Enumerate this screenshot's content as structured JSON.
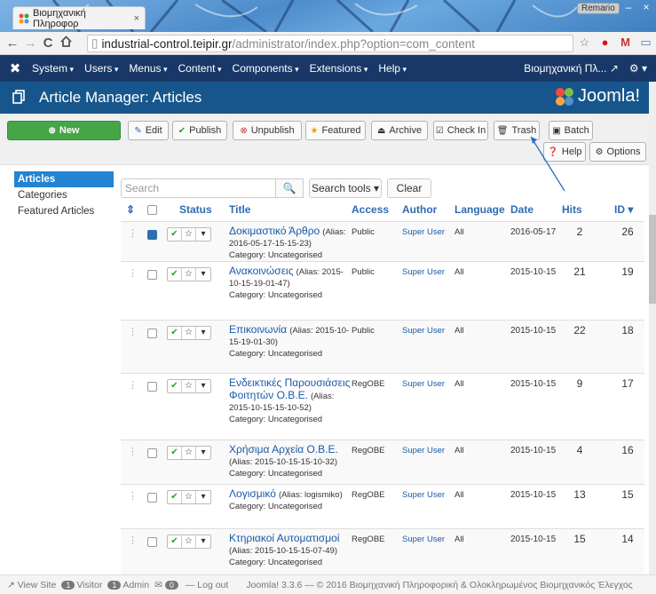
{
  "browser": {
    "tab_title": "Βιομηχανική Πληροφορ",
    "tab_close": "×",
    "user_badge": "Remario",
    "url_host": "industrial-control.teipir.gr",
    "url_path": "/administrator/index.php?option=com_content"
  },
  "topbar": {
    "menu": [
      "System",
      "Users",
      "Menus",
      "Content",
      "Components",
      "Extensions",
      "Help"
    ],
    "site_name": "Βιομηχανική Πλ..."
  },
  "header": {
    "title": "Article Manager: Articles",
    "logo_text": "Joomla!"
  },
  "toolbar": {
    "new": "New",
    "edit": "Edit",
    "publish": "Publish",
    "unpublish": "Unpublish",
    "featured": "Featured",
    "archive": "Archive",
    "checkin": "Check In",
    "trash": "Trash",
    "batch": "Batch",
    "help": "Help",
    "options": "Options"
  },
  "sidebar": {
    "items": [
      "Articles",
      "Categories",
      "Featured Articles"
    ]
  },
  "search": {
    "placeholder": "Search",
    "tools": "Search tools ▾",
    "clear": "Clear"
  },
  "table": {
    "headers": {
      "sort": "⇕",
      "status": "Status",
      "title": "Title",
      "access": "Access",
      "author": "Author",
      "language": "Language",
      "date": "Date",
      "hits": "Hits",
      "id": "ID ▾"
    },
    "rows": [
      {
        "title": "Δοκιμαστικό Άρθρο",
        "alias": "(Alias: 2016-05-17-15-15-23)",
        "category": "Category: Uncategorised",
        "access": "Public",
        "author": "Super User",
        "language": "All",
        "date": "2016-05-17",
        "hits": "2",
        "id": "26",
        "checked": true
      },
      {
        "title": "Ανακοινώσεις",
        "alias": "(Alias: 2015-10-15-19-01-47)",
        "category": "Category: Uncategorised",
        "access": "Public",
        "author": "Super User",
        "language": "All",
        "date": "2015-10-15",
        "hits": "21",
        "id": "19",
        "checked": false
      },
      {
        "title": "Επικοινωνία",
        "alias": "(Alias: 2015-10-15-19-01-30)",
        "category": "Category: Uncategorised",
        "access": "Public",
        "author": "Super User",
        "language": "All",
        "date": "2015-10-15",
        "hits": "22",
        "id": "18",
        "checked": false
      },
      {
        "title": "Ενδεικτικές Παρουσιάσεις Φοιτητών Ο.Β.Ε.",
        "alias": "(Alias: 2015-10-15-15-10-52)",
        "category": "Category: Uncategorised",
        "access": "RegOBE",
        "author": "Super User",
        "language": "All",
        "date": "2015-10-15",
        "hits": "9",
        "id": "17",
        "checked": false
      },
      {
        "title": "Χρήσιμα Αρχεία Ο.Β.Ε.",
        "alias": "(Alias: 2015-10-15-15-10-32)",
        "category": "Category: Uncategorised",
        "access": "RegOBE",
        "author": "Super User",
        "language": "All",
        "date": "2015-10-15",
        "hits": "4",
        "id": "16",
        "checked": false
      },
      {
        "title": "Λογισμικό",
        "alias": "(Alias: logismiko)",
        "category": "Category: Uncategorised",
        "access": "RegOBE",
        "author": "Super User",
        "language": "All",
        "date": "2015-10-15",
        "hits": "13",
        "id": "15",
        "checked": false
      },
      {
        "title": "Κτηριακοί Αυτοματισμοί",
        "alias": "(Alias: 2015-10-15-15-07-49)",
        "category": "Category: Uncategorised",
        "access": "RegOBE",
        "author": "Super User",
        "language": "All",
        "date": "2015-10-15",
        "hits": "15",
        "id": "14",
        "checked": false
      }
    ]
  },
  "footer": {
    "view_site": "View Site",
    "visitor_count": "1",
    "visitor": "Visitor",
    "admin_count": "1",
    "admin": "Admin",
    "msg_count": "0",
    "logout": "Log out",
    "copyright": "Joomla! 3.3.6 — © 2016 Βιομηχανική Πληροφορική & Ολοκληρωμένος Βιομηχανικός Έλεγχος"
  }
}
